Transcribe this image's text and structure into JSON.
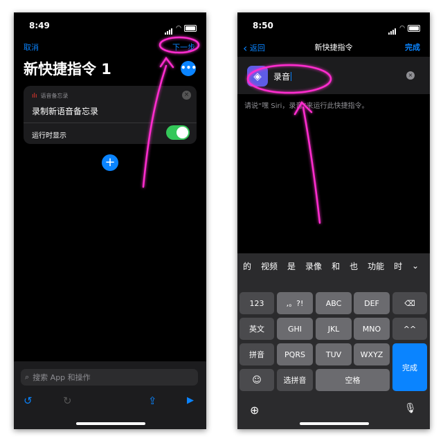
{
  "left": {
    "status_time": "8:49",
    "cancel_label": "取消",
    "next_label": "下一步",
    "title": "新快捷指令 1",
    "more_icon": "ellipsis-icon",
    "action_card": {
      "app_label": "语音备忘录",
      "close_glyph": "×",
      "action_label": "录制新语音备忘录",
      "toggle_label": "运行时显示",
      "toggle_on": true
    },
    "add_glyph": "+",
    "search_placeholder": "搜索 App 和操作",
    "search_glyph": "⌕",
    "toolbar": {
      "undo": "↺",
      "redo": "↻",
      "share": "⇪",
      "run": "▶"
    }
  },
  "right": {
    "status_time": "8:50",
    "back_label": "返回",
    "back_glyph": "‹",
    "title": "新快捷指令",
    "done_label": "完成",
    "phrase_value": "录音",
    "clear_glyph": "×",
    "app_glyph": "◈",
    "hint": "请说“嘿 Siri，录音”来运行此快捷指令。",
    "keyboard": {
      "candidates": [
        "的",
        "视频",
        "是",
        "录像",
        "和",
        "也",
        "功能",
        "时"
      ],
      "collapse_glyph": "⌄",
      "row1": [
        "123",
        ",。?!",
        "ABC",
        "DEF",
        "⌫"
      ],
      "row2": [
        "英文",
        "GHI",
        "JKL",
        "MNO",
        "^^"
      ],
      "row3": [
        "拼音",
        "PQRS",
        "TUV",
        "WXYZ"
      ],
      "row4": [
        "☺",
        "选拼音",
        "空格"
      ],
      "done": "完成",
      "globe_glyph": "⊕",
      "mic_glyph": "🎙"
    }
  },
  "colors": {
    "accent": "#0a84ff",
    "annotation": "#ff2dcf",
    "toggle": "#34c759"
  }
}
